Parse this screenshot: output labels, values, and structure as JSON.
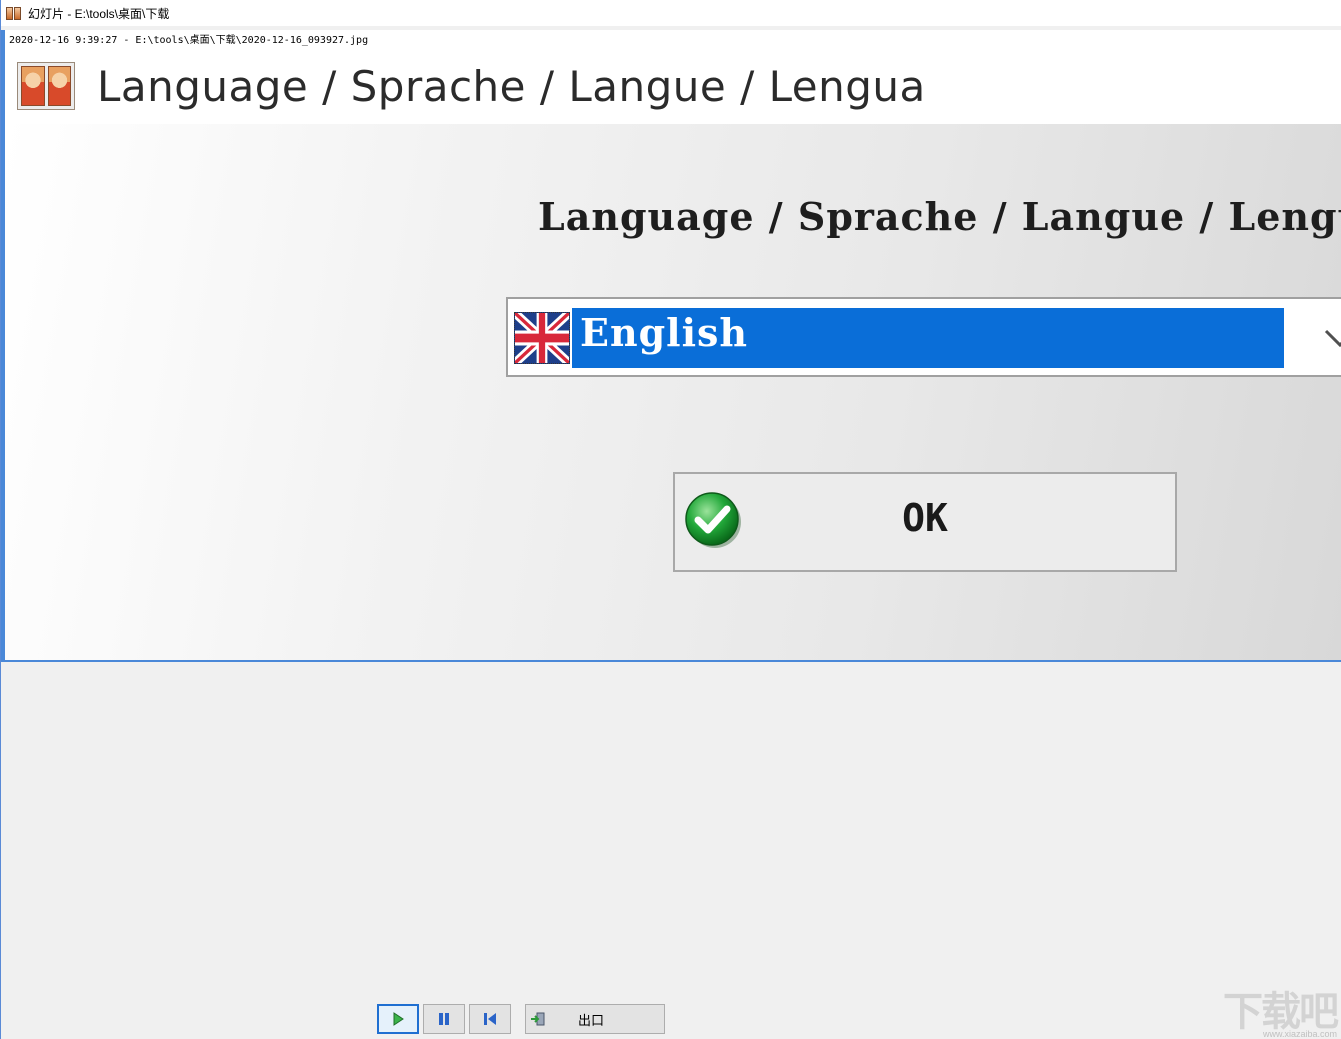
{
  "window": {
    "title": "幻灯片 - E:\\tools\\桌面\\下载"
  },
  "slide": {
    "caption": "2020-12-16 9:39:27 - E:\\tools\\桌面\\下载\\2020-12-16_093927.jpg"
  },
  "dialog": {
    "heading": "Language / Sprache  / Langue / Lengua",
    "prompt": "Language / Sprache  / Langue / Lengua",
    "language_select": {
      "selected": "English",
      "flag_icon": "uk-flag-icon"
    },
    "ok_button": {
      "label": "OK",
      "icon": "green-check-icon"
    }
  },
  "toolbar": {
    "play_icon": "play-icon",
    "pause_icon": "pause-icon",
    "previous_icon": "skip-back-icon",
    "exit_label": "出口"
  },
  "watermark": {
    "text": "下载吧",
    "url": "www.xiazaiba.com"
  }
}
